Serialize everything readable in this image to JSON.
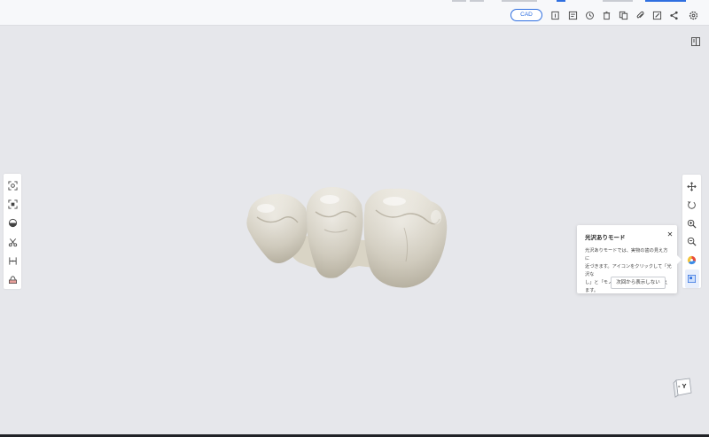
{
  "topbar": {
    "cad_label": "CAD",
    "icons": [
      "info-panel-icon",
      "memo-icon",
      "history-icon",
      "delete-icon",
      "copy-icon",
      "attachment-icon",
      "edit-icon",
      "share-icon",
      "settings-icon"
    ]
  },
  "left_toolbar": {
    "tools": [
      "fit-view-icon",
      "select-area-icon",
      "occlusal-plane-icon",
      "scissors-cut-icon",
      "margin-line-icon",
      "clip-section-icon"
    ]
  },
  "right_toolbar": {
    "tools": [
      "pan-move-icon",
      "rotate-icon",
      "zoom-in-icon",
      "zoom-out-icon",
      "color-mode-icon",
      "layer-toggle-icon"
    ]
  },
  "tooltip": {
    "title": "光沢ありモード",
    "close": "✕",
    "line1": "光沢ありモードでは、実物の歯の見え方に",
    "line2": "近づきます。アイコンをクリックして「光沢な",
    "line3": "し」と「モノクロ」モード間で切り替えます。",
    "dismiss": "次回から表示しない"
  },
  "orientation": {
    "label": "- Y"
  },
  "colors": {
    "accent": "#2f6fe0",
    "background": "#e6e7eb",
    "tooth": "#e2ddd0"
  }
}
